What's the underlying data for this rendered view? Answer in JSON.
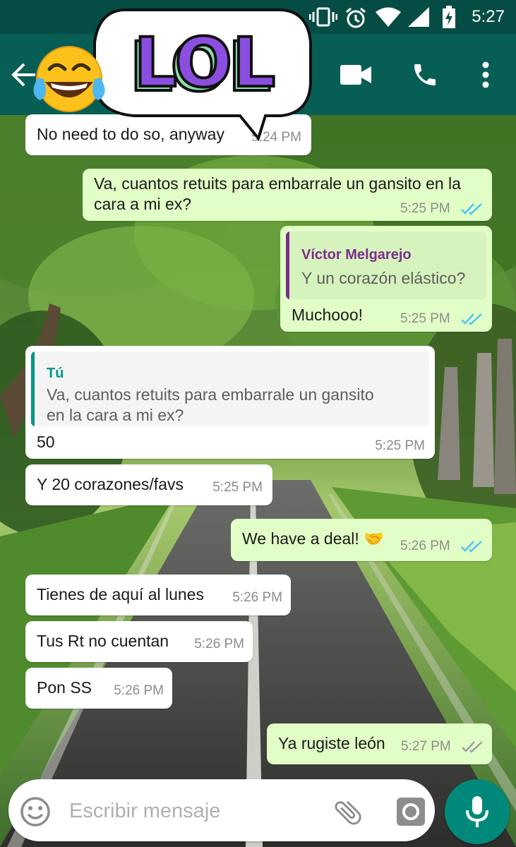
{
  "status_bar": {
    "time": "5:27",
    "icons": [
      "vibrate-icon",
      "alarm-icon",
      "wifi-icon",
      "signal-icon",
      "battery-charging-icon"
    ]
  },
  "app_bar": {
    "icons": [
      "back-arrow-icon",
      "video-call-icon",
      "phone-icon",
      "more-vert-icon"
    ]
  },
  "sticker": {
    "text": "LOL",
    "emoji": "face-with-tears-of-joy"
  },
  "messages": [
    {
      "direction": "in",
      "text": "No need to do so, anyway",
      "time": "5:24 PM"
    },
    {
      "direction": "out",
      "lines": [
        "Va, cuantos retuits para embarrale un gansito en la",
        "cara a mi ex?"
      ],
      "time": "5:25 PM",
      "status": "read"
    },
    {
      "direction": "out",
      "quote": {
        "author": "Víctor Melgarejo",
        "text": "Y un corazón elástico?"
      },
      "text": "Muchooo!",
      "time": "5:25 PM",
      "status": "read"
    },
    {
      "direction": "in",
      "quote": {
        "author": "Tú",
        "lines": [
          "Va, cuantos retuits para embarrale un gansito",
          "en la cara a mi ex?"
        ]
      },
      "text": "50",
      "time": "5:25 PM"
    },
    {
      "direction": "in",
      "text": "Y 20 corazones/favs",
      "time": "5:25 PM"
    },
    {
      "direction": "out",
      "text": "We have a deal! 🤝",
      "time": "5:26 PM",
      "status": "read"
    },
    {
      "direction": "in",
      "text": "Tienes de aquí al lunes",
      "time": "5:26 PM"
    },
    {
      "direction": "in",
      "text": "Tus Rt no cuentan",
      "time": "5:26 PM"
    },
    {
      "direction": "in",
      "text": "Pon SS",
      "time": "5:26 PM"
    },
    {
      "direction": "out",
      "text": "Ya rugiste león",
      "time": "5:27 PM",
      "status": "delivered"
    }
  ],
  "composer": {
    "placeholder": "Escribir mensaje",
    "icons": [
      "emoji-icon",
      "attach-icon",
      "camera-icon",
      "mic-icon"
    ]
  },
  "colors": {
    "header": "#075e54",
    "status_bar": "#054d44",
    "outgoing_bubble": "#e1fec6",
    "incoming_bubble": "#ffffff",
    "read_ticks": "#4fc3f7",
    "delivered_ticks": "#9e9e9e",
    "quote_author_victor": "#7b2d8e",
    "quote_author_tu": "#009688",
    "mic_button": "#00897b"
  }
}
